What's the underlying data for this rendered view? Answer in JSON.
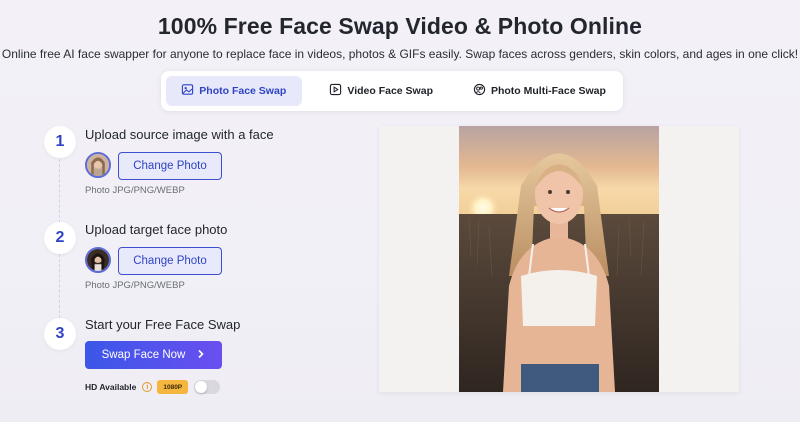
{
  "header": {
    "title": "100% Free Face Swap Video & Photo Online",
    "subtitle": "Online free AI face swapper for anyone to replace face in videos, photos & GIFs easily. Swap faces across genders, skin colors, and ages in one click!"
  },
  "tabs": [
    {
      "label": "Photo Face Swap",
      "icon": "image-icon",
      "active": true
    },
    {
      "label": "Video Face Swap",
      "icon": "play-icon",
      "active": false
    },
    {
      "label": "Photo Multi-Face Swap",
      "icon": "faces-icon",
      "active": false
    }
  ],
  "steps": [
    {
      "number": "1",
      "title": "Upload source image with a face",
      "button": "Change Photo",
      "hint": "Photo JPG/PNG/WEBP"
    },
    {
      "number": "2",
      "title": "Upload target face photo",
      "button": "Change Photo",
      "hint": "Photo JPG/PNG/WEBP"
    },
    {
      "number": "3",
      "title": "Start your Free Face Swap",
      "button": "Swap Face Now"
    }
  ],
  "hd": {
    "label": "HD Available",
    "badge": "1080P",
    "enabled": false
  },
  "colors": {
    "accent": "#2f43c4",
    "button_gradient_start": "#3b57e8",
    "button_gradient_end": "#6a4ff0",
    "badge": "#f4b63e"
  }
}
